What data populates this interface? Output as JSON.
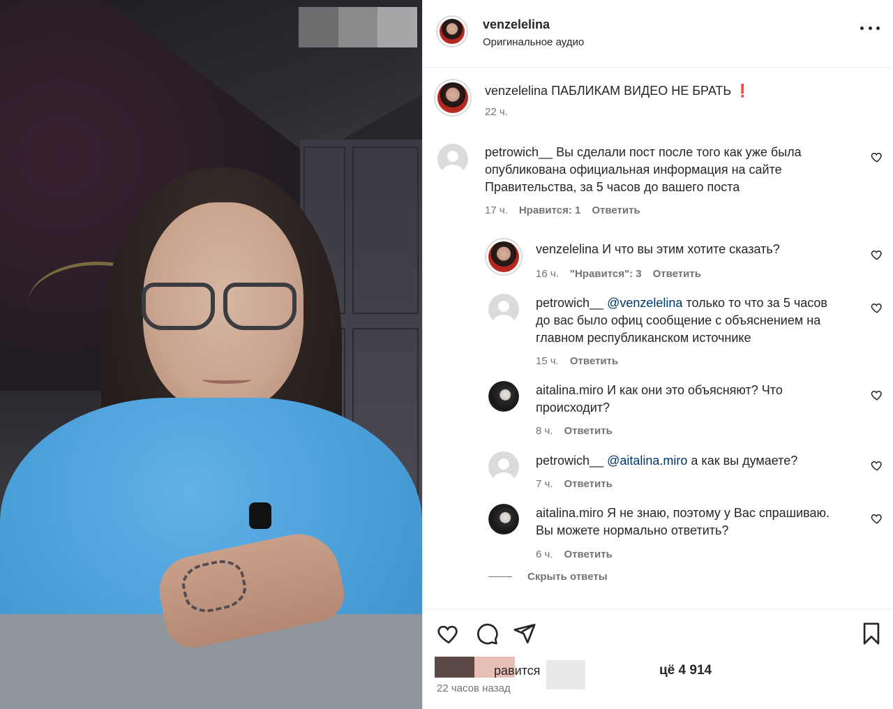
{
  "header": {
    "username": "venzelelina",
    "audio": "Оригинальное аудио"
  },
  "caption": {
    "username": "venzelelina",
    "text": "ПАБЛИКАМ ВИДЕО НЕ БРАТЬ",
    "emoji": "❗",
    "time": "22 ч."
  },
  "comments": [
    {
      "username": "petrowich__",
      "lines": [
        "Вы сделали пост после того как уже была",
        "опубликована официальная информация на сайте",
        "Правительства, за 5 часов до вашего поста"
      ],
      "time": "17 ч.",
      "likes": "Нравится: 1",
      "reply": "Ответить"
    }
  ],
  "replies": [
    {
      "username": "venzelelina",
      "text": "И что вы этим хотите сказать?",
      "time": "16 ч.",
      "likes": "\"Нравится\": 3",
      "reply": "Ответить"
    },
    {
      "username": "petrowich__",
      "mention": "@venzelelina",
      "line1_rest": "только то что за 5 часов",
      "line2": "до вас было офиц сообщение с объяснением на",
      "line3": "главном республиканском источнике",
      "time": "15 ч.",
      "reply": "Ответить"
    },
    {
      "username": "aitalina.miro",
      "line1_rest": "И как они это объясняют? Что",
      "line2": "происходит?",
      "time": "8 ч.",
      "reply": "Ответить"
    },
    {
      "username": "petrowich__",
      "mention": "@aitalina.miro",
      "line1_rest": "а как вы думаете?",
      "time": "7 ч.",
      "reply": "Ответить"
    },
    {
      "username": "aitalina.miro",
      "line1_rest": "Я не знаю, поэтому у Вас спрашиваю.",
      "line2": "Вы можете нормально ответить?",
      "time": "6 ч.",
      "reply": "Ответить"
    }
  ],
  "hide_replies": "Скрыть ответы",
  "likes_partial": "равится",
  "likes_count_partial": "цё 4 914",
  "post_time": "22 часов назад",
  "colors": {
    "text": "#262626",
    "muted": "#737373",
    "mention": "#00376b",
    "emoji_red": "#e0245e"
  },
  "icons": [
    "more-icon",
    "heart-icon",
    "comment-icon",
    "share-icon",
    "bookmark-icon"
  ]
}
